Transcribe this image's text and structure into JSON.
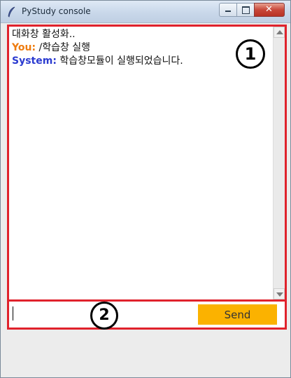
{
  "window": {
    "title": "PyStudy console",
    "close_glyph": "✕"
  },
  "chat": {
    "lines": [
      {
        "prefix": "",
        "text": "대화창 활성화.."
      },
      {
        "prefix": "You:",
        "text": " /학습창 실행",
        "prefix_color": "#ee7c10"
      },
      {
        "prefix": "System:",
        "text": " 학습창모듈이 실행되었습니다.",
        "prefix_color": "#2b3bd0"
      }
    ]
  },
  "input": {
    "value": "",
    "placeholder": ""
  },
  "send": {
    "label": "Send",
    "color": "#fbb200"
  },
  "callouts": {
    "first": "1",
    "second": "2"
  },
  "colors": {
    "highlight_border": "#e0222c"
  }
}
